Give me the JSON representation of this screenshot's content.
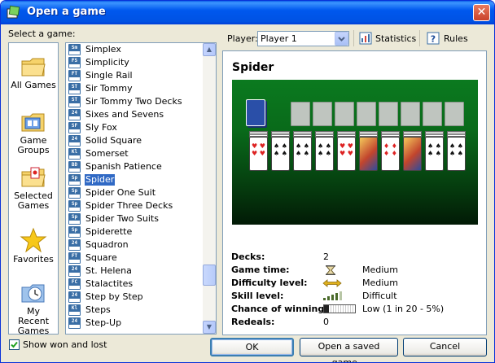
{
  "window": {
    "title": "Open a game"
  },
  "left": {
    "select_label": "Select a game:"
  },
  "groups": [
    {
      "label": "All Games",
      "icon": "folder-icon"
    },
    {
      "label": "Game Groups",
      "icon": "game-groups-icon"
    },
    {
      "label": "Selected Games",
      "icon": "selected-folder-icon"
    },
    {
      "label": "Favorites",
      "icon": "star-icon"
    },
    {
      "label": "My Recent Games",
      "icon": "recent-games-icon"
    }
  ],
  "games": [
    {
      "code": "Sm",
      "name": "Simplex"
    },
    {
      "code": "FS",
      "name": "Simplicity"
    },
    {
      "code": "FT",
      "name": "Single Rail"
    },
    {
      "code": "ST",
      "name": "Sir Tommy"
    },
    {
      "code": "ST",
      "name": "Sir Tommy Two Decks"
    },
    {
      "code": "24",
      "name": "Sixes and Sevens"
    },
    {
      "code": "SF",
      "name": "Sly Fox"
    },
    {
      "code": "24",
      "name": "Solid Square"
    },
    {
      "code": "Kl",
      "name": "Somerset"
    },
    {
      "code": "BD",
      "name": "Spanish Patience"
    },
    {
      "code": "Sp",
      "name": "Spider"
    },
    {
      "code": "Sp",
      "name": "Spider One Suit"
    },
    {
      "code": "Sp",
      "name": "Spider Three Decks"
    },
    {
      "code": "Sp",
      "name": "Spider Two Suits"
    },
    {
      "code": "Sp",
      "name": "Spiderette"
    },
    {
      "code": "24",
      "name": "Squadron"
    },
    {
      "code": "FT",
      "name": "Square"
    },
    {
      "code": "24",
      "name": "St. Helena"
    },
    {
      "code": "FC",
      "name": "Stalactites"
    },
    {
      "code": "24",
      "name": "Step by Step"
    },
    {
      "code": "Kl",
      "name": "Steps"
    },
    {
      "code": "24",
      "name": "Step-Up"
    }
  ],
  "selected_game": "Spider",
  "toolbar": {
    "player_label": "Player:",
    "player_value": "Player 1",
    "statistics_label": "Statistics",
    "rules_label": "Rules"
  },
  "details": {
    "title": "Spider",
    "decks_label": "Decks:",
    "decks_value": "2",
    "game_time_label": "Game time:",
    "game_time_value": "Medium",
    "difficulty_label": "Difficulty level:",
    "difficulty_value": "Medium",
    "skill_label": "Skill level:",
    "skill_value": "Difficult",
    "chance_label": "Chance of winning:",
    "chance_value": "Low  (1 in 20  -  5%)",
    "redeals_label": "Redeals:",
    "redeals_value": "0",
    "skill_level_bars": 3,
    "chance_fraction": 0.05
  },
  "bottom": {
    "show_won_lost_label": "Show won and lost",
    "show_won_lost_checked": true,
    "ok_label": "OK",
    "open_saved_label": "Open a saved game...",
    "cancel_label": "Cancel"
  },
  "colors": {
    "titlebar": "#0054E3",
    "selection": "#316AC5",
    "felt": "#0B7A1F"
  }
}
